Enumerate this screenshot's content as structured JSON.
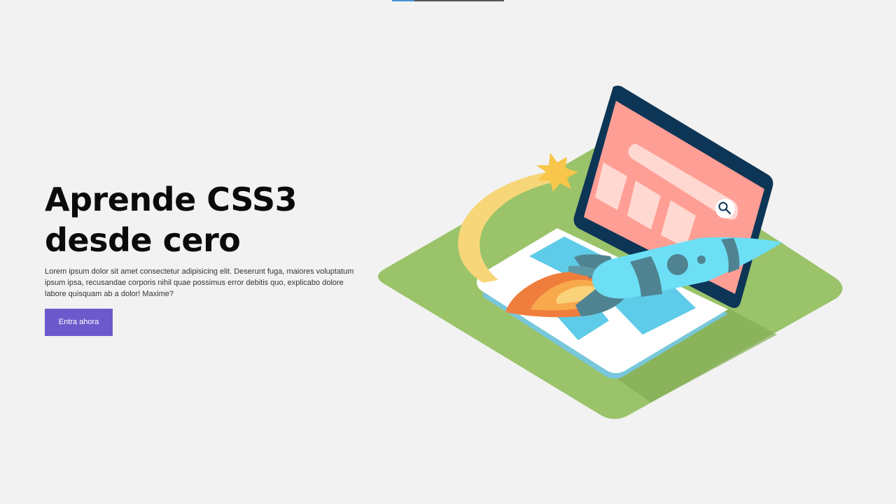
{
  "hero": {
    "title_line1": "Aprende CSS3",
    "title_line2": "desde cero",
    "description": "Lorem ipsum dolor sit amet consectetur adipisicing elit. Deserunt fuga, maiores voluptatum ipsum ipsa, recusandae corporis nihil quae possimus error debitis quo, explicabo dolore labore quisquam ab a dolor! Maxime?",
    "cta_label": "Entra ahora"
  },
  "illustration": {
    "subject": "laptop-with-rocket",
    "search_icon": "search-icon"
  },
  "colors": {
    "background": "#f2f2f2",
    "cta": "#6c5acd",
    "ground": "#9ac36a",
    "laptop_frame": "#0d3556",
    "screen": "#ff9e94",
    "rocket": "#6cdff5",
    "flame": "#f5a742"
  }
}
